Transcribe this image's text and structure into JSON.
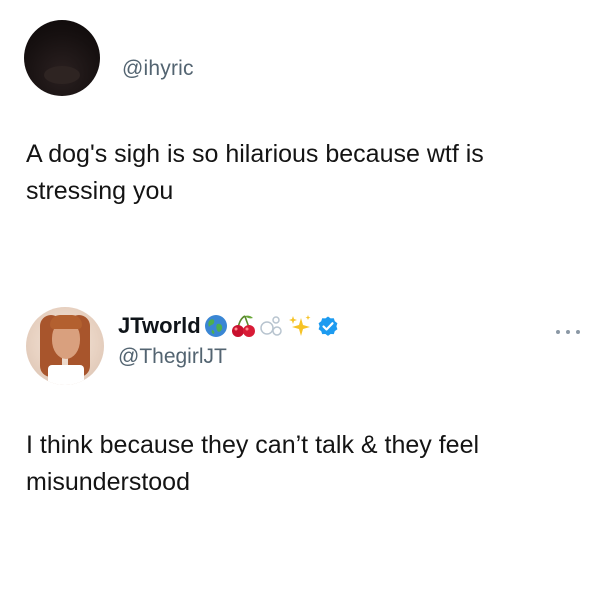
{
  "original_tweet": {
    "handle": "@ihyric",
    "text": "A dog's sigh is so hilarious because wtf is stressing you"
  },
  "reply_tweet": {
    "display_name": "JTworld",
    "name_emojis": [
      "globe-icon",
      "cherries-icon",
      "bubbles-icon",
      "sparkles-icon"
    ],
    "verified": true,
    "verified_color": "#1d9bf0",
    "handle": "@ThegirlJT",
    "more_label": "...",
    "text": "I think because they can’t talk & they feel misunderstood"
  },
  "colors": {
    "handle": "#536471",
    "text": "#141414",
    "name": "#0f1419"
  }
}
